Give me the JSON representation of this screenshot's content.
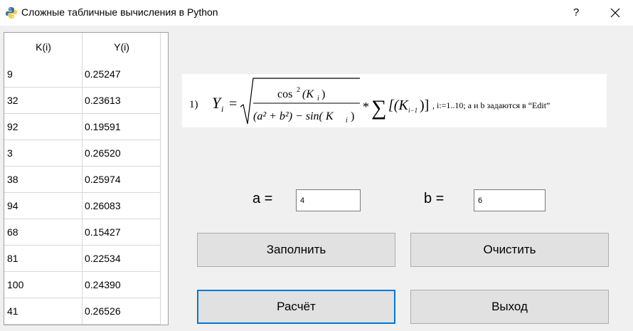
{
  "window": {
    "title": "Сложные табличные вычисления в Python",
    "help_label": "?"
  },
  "table": {
    "columns": [
      "K(i)",
      "Y(i)"
    ],
    "rows": [
      [
        "9",
        "0.25247"
      ],
      [
        "32",
        "0.23613"
      ],
      [
        "92",
        "0.19591"
      ],
      [
        "3",
        "0.26520"
      ],
      [
        "38",
        "0.25974"
      ],
      [
        "94",
        "0.26083"
      ],
      [
        "68",
        "0.15427"
      ],
      [
        "81",
        "0.22534"
      ],
      [
        "100",
        "0.24390"
      ],
      [
        "41",
        "0.26526"
      ]
    ]
  },
  "formula": {
    "number": "1)",
    "lhs": "Y",
    "lhs_sub": "i",
    "equals": "=",
    "numerator": "cos",
    "numerator_sup": "2",
    "numerator_arg": "(K",
    "numerator_arg_sub": "i",
    "numerator_close": ")",
    "denominator": "(a² + b²) − sin( K",
    "denominator_sub": "i",
    "denominator_close": ")",
    "times": "*",
    "sum": "∑",
    "sum_arg": "[(K",
    "sum_arg_sub": "i−1",
    "sum_close": ")]",
    "note": ", i:=1..10; a и b задаются в “Edit”"
  },
  "inputs": {
    "a_label": "a  =",
    "a_value": "4",
    "b_label": "b  =",
    "b_value": "6"
  },
  "buttons": {
    "fill": "Заполнить",
    "clear": "Очистить",
    "calc": "Расчёт",
    "exit": "Выход"
  },
  "colors": {
    "focus_border": "#0078d7",
    "button_face": "#e1e1e1"
  }
}
